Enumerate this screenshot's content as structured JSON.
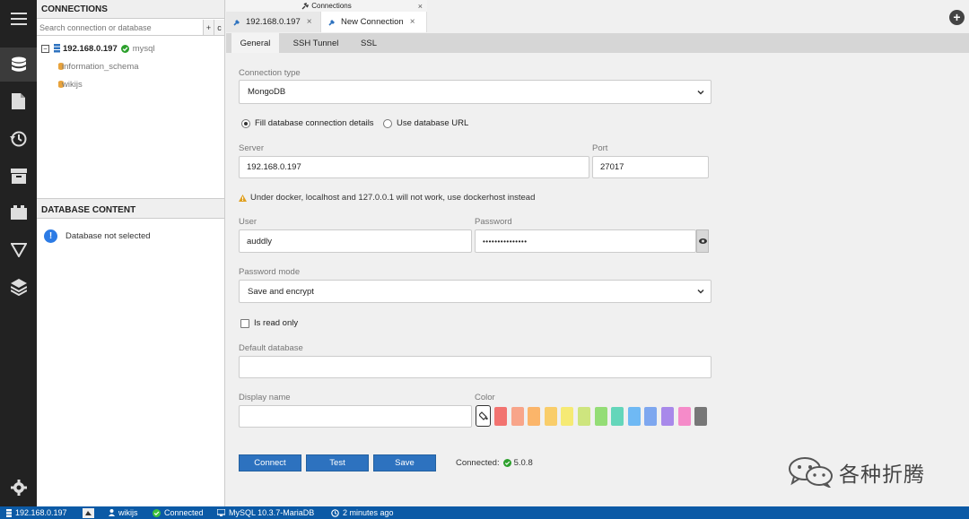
{
  "sidebar": {
    "connections_title": "CONNECTIONS",
    "search_placeholder": "Search connection or database",
    "add_btn": "+",
    "refresh_btn": "c",
    "server": {
      "toggle": "−",
      "name": "192.168.0.197",
      "engine": "mysql"
    },
    "databases": [
      "information_schema",
      "wikijs"
    ],
    "db_content_title": "DATABASE CONTENT",
    "db_not_selected": "Database not selected",
    "info_glyph": "!"
  },
  "tabs": {
    "connections_title": "Connections",
    "close_glyph": "×",
    "items": [
      {
        "label": "192.168.0.197"
      },
      {
        "label": "New Connection"
      }
    ],
    "add_glyph": "+"
  },
  "subtabs": [
    "General",
    "SSH Tunnel",
    "SSL"
  ],
  "form": {
    "connection_type_label": "Connection type",
    "connection_type": "MongoDB",
    "radio_fill": "Fill database connection details",
    "radio_url": "Use database URL",
    "server_label": "Server",
    "server": "192.168.0.197",
    "port_label": "Port",
    "port": "27017",
    "warning": "Under docker, localhost and 127.0.0.1 will not work, use dockerhost instead",
    "user_label": "User",
    "user": "auddly",
    "password_label": "Password",
    "password": "•••••••••••••••",
    "password_mode_label": "Password mode",
    "password_mode": "Save and encrypt",
    "read_only_label": "Is read only",
    "default_db_label": "Default database",
    "default_db": "",
    "display_name_label": "Display name",
    "display_name": "",
    "color_label": "Color",
    "swatches": [
      "#f27370",
      "#f8a58a",
      "#fbb56a",
      "#f9cd6a",
      "#f6ea74",
      "#cee57e",
      "#94dd76",
      "#64d6ba",
      "#6fb9f4",
      "#7ea7ef",
      "#a889ea",
      "#f58bc9",
      "#777777"
    ]
  },
  "buttons": {
    "connect": "Connect",
    "test": "Test",
    "save": "Save"
  },
  "connected": {
    "label": "Connected:",
    "version": "5.0.8"
  },
  "watermark": "各种折腾",
  "statusbar": {
    "server": "192.168.0.197",
    "database": "wikijs",
    "status": "Connected",
    "engine": "MySQL 10.3.7-MariaDB",
    "time": "2 minutes ago"
  },
  "colors": {
    "accent": "#2d72bf",
    "statusbar": "#0b5aa6",
    "iconbar": "#222222",
    "ok": "#2ca02c"
  }
}
